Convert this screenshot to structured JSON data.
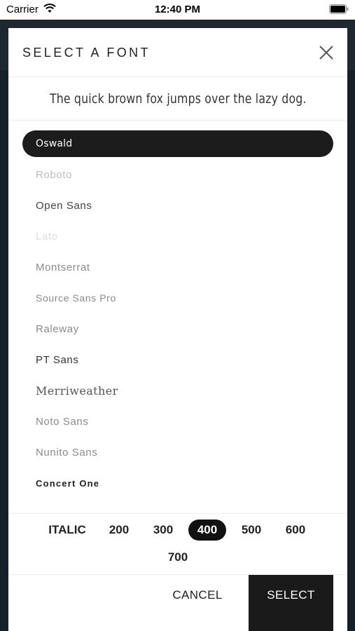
{
  "status_bar": {
    "carrier": "Carrier",
    "time": "12:40 PM"
  },
  "modal": {
    "title": "SELECT A FONT",
    "preview_text": "The quick brown fox jumps over the lazy dog."
  },
  "fonts": [
    "Oswald",
    "Roboto",
    "Open Sans",
    "Lato",
    "Montserrat",
    "Source Sans Pro",
    "Raleway",
    "PT Sans",
    "Merriweather",
    "Noto Sans",
    "Nunito Sans",
    "Concert One"
  ],
  "selected_font": "Oswald",
  "weights": [
    "ITALIC",
    "200",
    "300",
    "400",
    "500",
    "600",
    "700"
  ],
  "selected_weight": "400",
  "actions": {
    "cancel": "CANCEL",
    "select": "SELECT"
  }
}
